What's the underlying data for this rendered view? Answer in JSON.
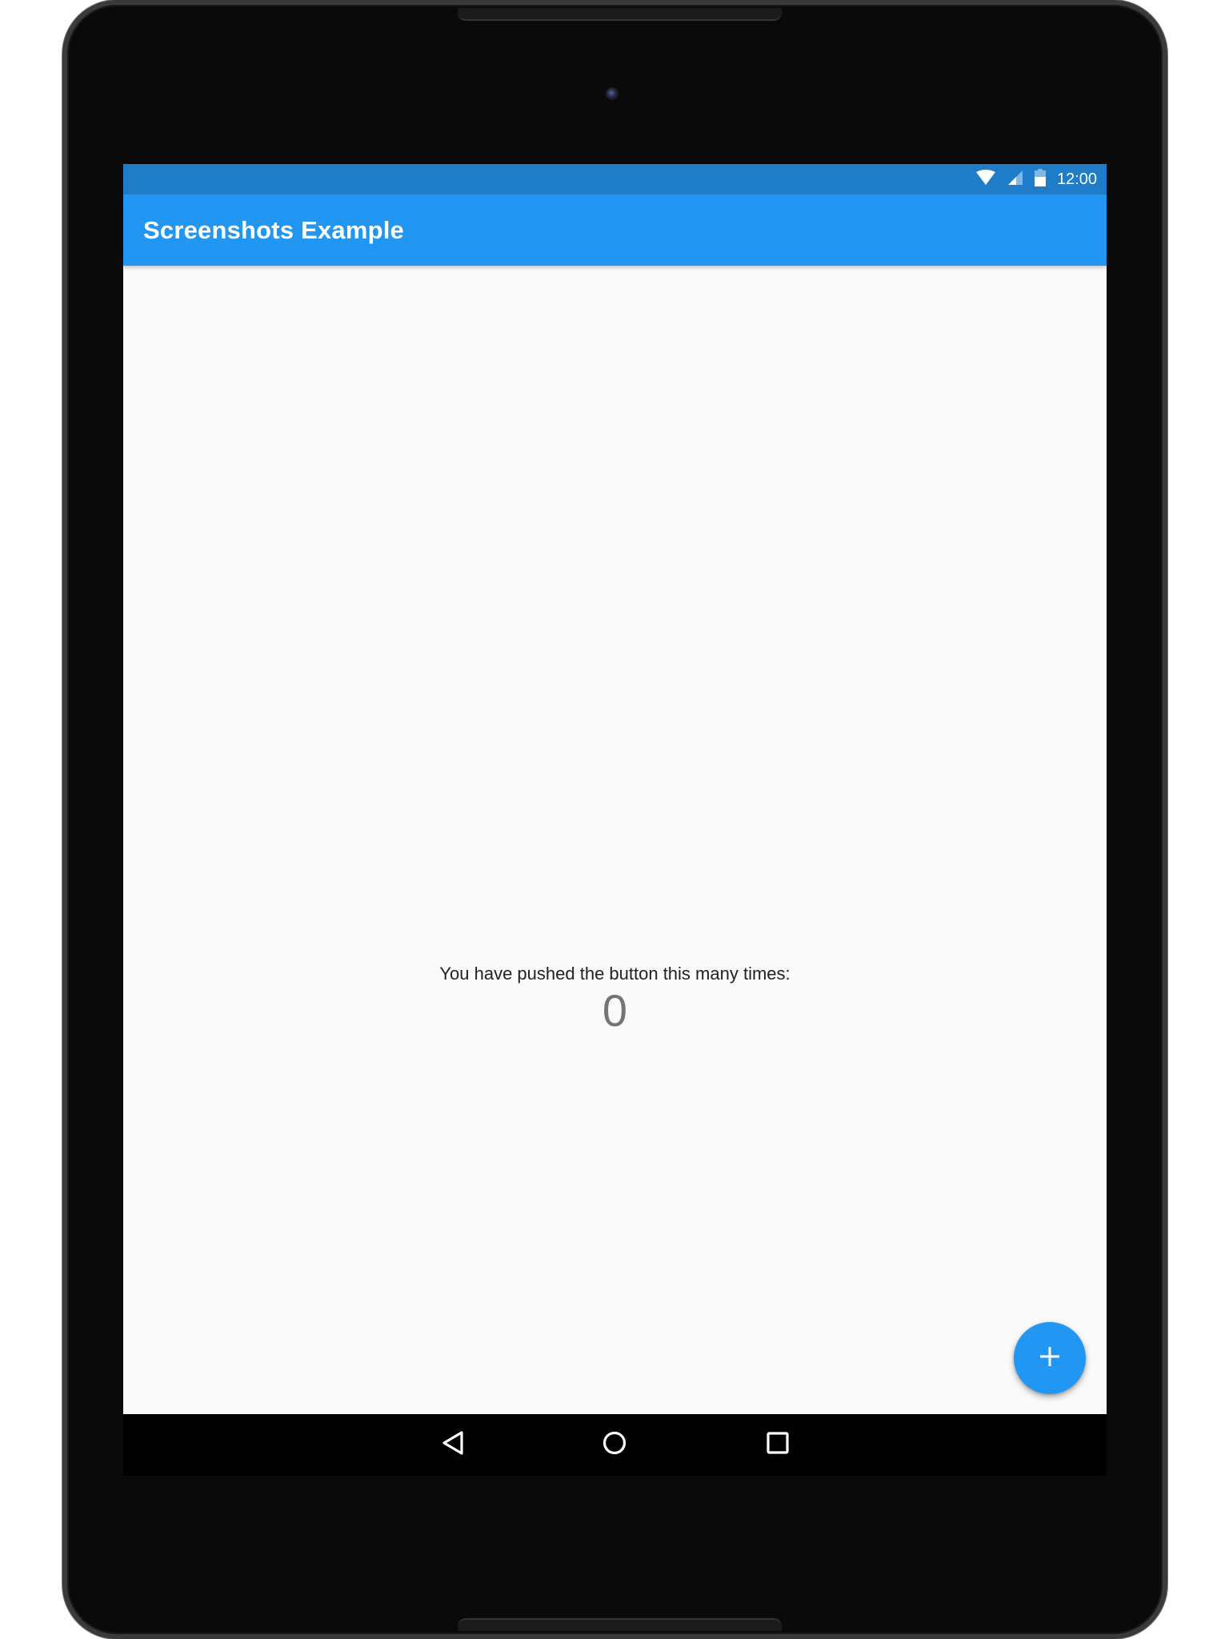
{
  "status_bar": {
    "time": "12:00",
    "icons": [
      "wifi-icon",
      "cell-signal-icon",
      "battery-icon"
    ]
  },
  "app_bar": {
    "title": "Screenshots Example"
  },
  "main": {
    "message": "You have pushed the button this many times:",
    "counter": "0"
  },
  "fab": {
    "icon": "plus-icon"
  },
  "nav_bar": {
    "buttons": [
      "back-icon",
      "home-icon",
      "recents-icon"
    ]
  },
  "colors": {
    "primary": "#2196f3",
    "status_bar": "#1e7cc9",
    "background": "#fafafa",
    "counter_text": "#757575"
  }
}
